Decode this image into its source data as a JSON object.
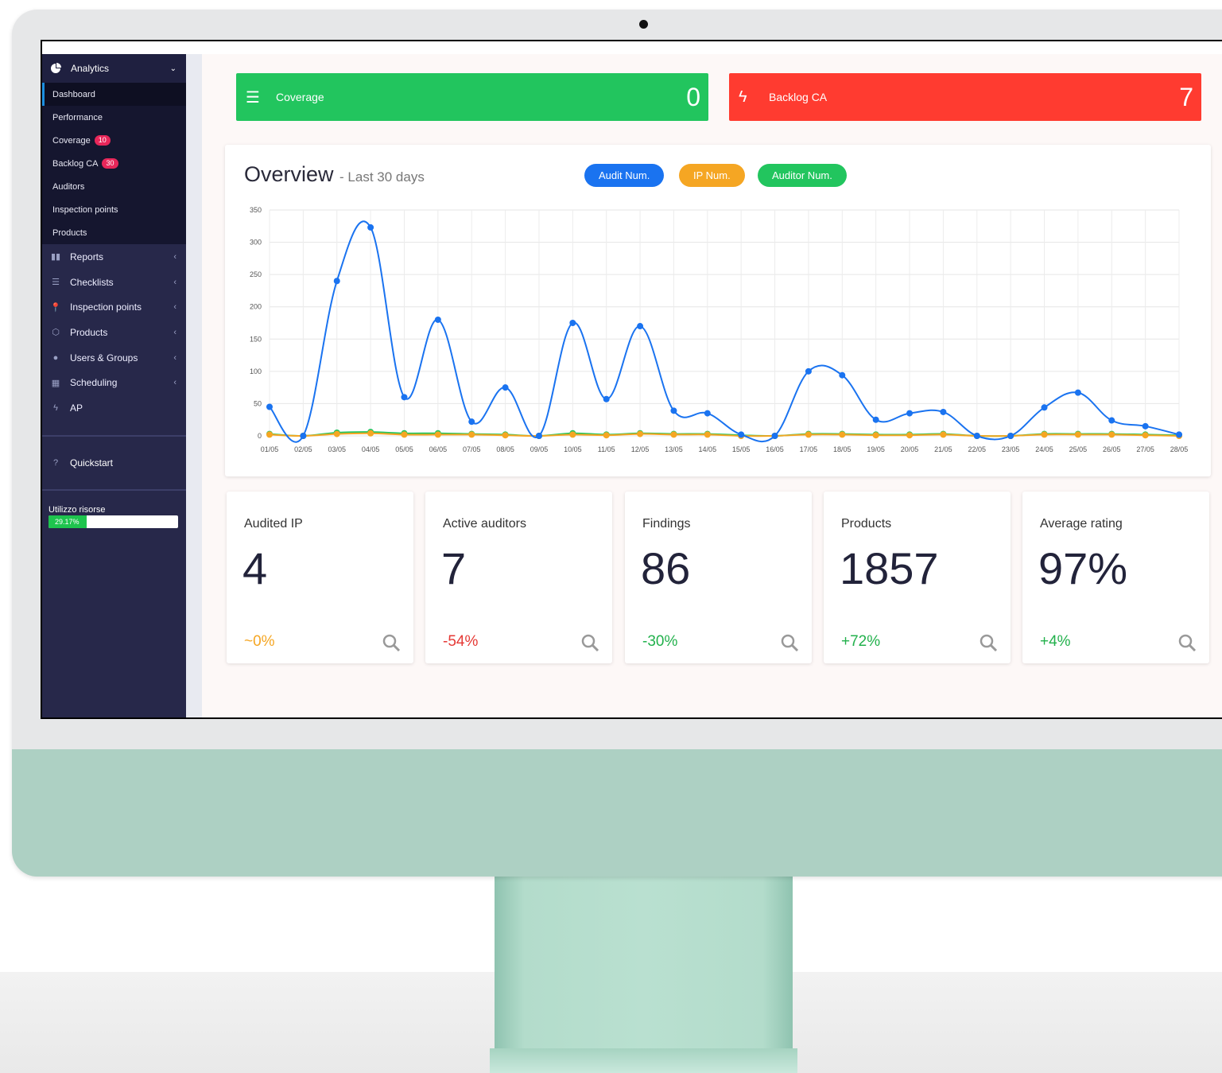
{
  "sidebar": {
    "header": {
      "label": "Analytics",
      "icon": "pie-chart-icon"
    },
    "sub_items": [
      {
        "label": "Dashboard",
        "badge": null,
        "active": true
      },
      {
        "label": "Performance",
        "badge": null
      },
      {
        "label": "Coverage",
        "badge": "10"
      },
      {
        "label": "Backlog CA",
        "badge": "30"
      },
      {
        "label": "Auditors",
        "badge": null
      },
      {
        "label": "Inspection points",
        "badge": null
      },
      {
        "label": "Products",
        "badge": null
      }
    ],
    "items": [
      {
        "label": "Reports",
        "icon": "book-icon"
      },
      {
        "label": "Checklists",
        "icon": "list-icon"
      },
      {
        "label": "Inspection points",
        "icon": "pin-icon"
      },
      {
        "label": "Products",
        "icon": "cube-icon"
      },
      {
        "label": "Users & Groups",
        "icon": "user-circle-icon"
      },
      {
        "label": "Scheduling",
        "icon": "calendar-icon"
      },
      {
        "label": "AP",
        "icon": "bolt-icon"
      }
    ],
    "quickstart": {
      "label": "Quickstart",
      "icon": "question-icon"
    },
    "resources": {
      "label": "Utilizzo risorse",
      "percent_text": "29.17%",
      "fraction": 0.2917
    }
  },
  "tiles": {
    "coverage": {
      "label": "Coverage",
      "value": "0",
      "icon": "list-icon",
      "color": "#22c55e"
    },
    "backlog": {
      "label": "Backlog CA",
      "value": "7",
      "icon": "bolt-icon",
      "color": "#ff3b30"
    }
  },
  "overview": {
    "title": "Overview",
    "subtitle": "- Last 30 days",
    "buttons": [
      {
        "label": "Audit Num.",
        "color": "#1a73f0"
      },
      {
        "label": "IP Num.",
        "color": "#f5a623"
      },
      {
        "label": "Auditor Num.",
        "color": "#22c55e"
      }
    ]
  },
  "chart_data": {
    "type": "line",
    "title": "",
    "xlabel": "",
    "ylabel": "",
    "ylim": [
      0,
      350
    ],
    "yticks": [
      0,
      50,
      100,
      150,
      200,
      250,
      300,
      350
    ],
    "grid": true,
    "categories": [
      "01/05",
      "02/05",
      "03/05",
      "04/05",
      "05/05",
      "06/05",
      "07/05",
      "08/05",
      "09/05",
      "10/05",
      "11/05",
      "12/05",
      "13/05",
      "14/05",
      "15/05",
      "16/05",
      "17/05",
      "18/05",
      "19/05",
      "20/05",
      "21/05",
      "22/05",
      "23/05",
      "24/05",
      "25/05",
      "26/05",
      "27/05",
      "28/05"
    ],
    "series": [
      {
        "color": "#1a73f0",
        "values": [
          45,
          0,
          240,
          323,
          60,
          180,
          22,
          75,
          0,
          175,
          57,
          170,
          39,
          35,
          2,
          0,
          100,
          94,
          25,
          35,
          37,
          0,
          0,
          44,
          67,
          24,
          15,
          2
        ]
      },
      {
        "color": "#f5a623",
        "values": [
          2,
          0,
          3,
          4,
          2,
          2,
          2,
          1,
          0,
          2,
          1,
          3,
          2,
          2,
          0,
          0,
          2,
          2,
          1,
          1,
          2,
          0,
          0,
          2,
          2,
          2,
          1,
          0
        ]
      },
      {
        "color": "#22c55e",
        "values": [
          3,
          0,
          5,
          6,
          4,
          4,
          3,
          2,
          0,
          4,
          2,
          4,
          3,
          3,
          1,
          0,
          3,
          3,
          2,
          2,
          3,
          0,
          0,
          3,
          3,
          3,
          2,
          1
        ]
      }
    ]
  },
  "cards": [
    {
      "label": "Audited IP",
      "value": "4",
      "change": "~0%",
      "change_color": "#f5a623"
    },
    {
      "label": "Active auditors",
      "value": "7",
      "change": "-54%",
      "change_color": "#e53935"
    },
    {
      "label": "Findings",
      "value": "86",
      "change": "-30%",
      "change_color": "#22b14c"
    },
    {
      "label": "Products",
      "value": "1857",
      "change": "+72%",
      "change_color": "#22b14c"
    },
    {
      "label": "Average rating",
      "value": "97%",
      "change": "+4%",
      "change_color": "#22b14c"
    }
  ]
}
